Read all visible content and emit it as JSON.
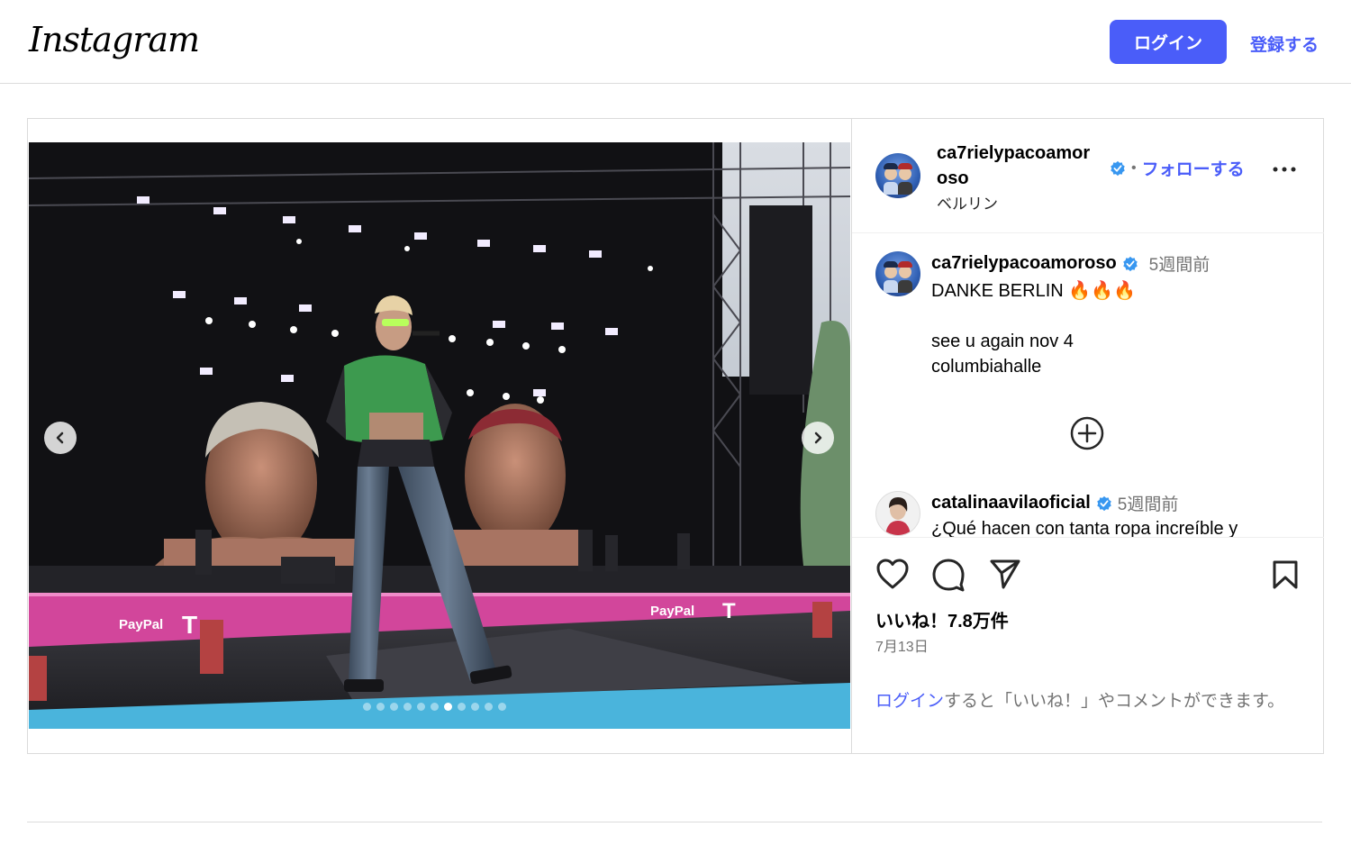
{
  "header": {
    "logo": "Instagram",
    "login_button": "ログイン",
    "signup_link": "登録する"
  },
  "post": {
    "author": {
      "username_line1": "ca7rielypacoamor",
      "username_line2": "oso",
      "location": "ベルリン",
      "verified": true
    },
    "follow_separator": "•",
    "follow_label": "フォローする",
    "carousel": {
      "total_slides": 11,
      "active_slide": 7,
      "prev_icon": "chevron-left-icon",
      "next_icon": "chevron-right-icon"
    },
    "caption": {
      "username": "ca7rielypacoamoroso",
      "time": "5週間前",
      "line1": "DANKE BERLIN 🔥🔥🔥",
      "line2": "see u again nov 4",
      "line3": "columbiahalle"
    },
    "comments": [
      {
        "username": "catalinaavilaoficial",
        "time": "5週間前",
        "text": "¿Qué hacen con tanta ropa increíble y"
      }
    ],
    "likes": "いいね！7.8万件",
    "date": "7月13日",
    "login_note_link": "ログイン",
    "login_note_rest": "すると「いいね！」やコメントができます。"
  },
  "colors": {
    "accent": "#4a5df9",
    "verified": "#3897f0",
    "muted": "#737373",
    "border": "#dbdbdb"
  }
}
